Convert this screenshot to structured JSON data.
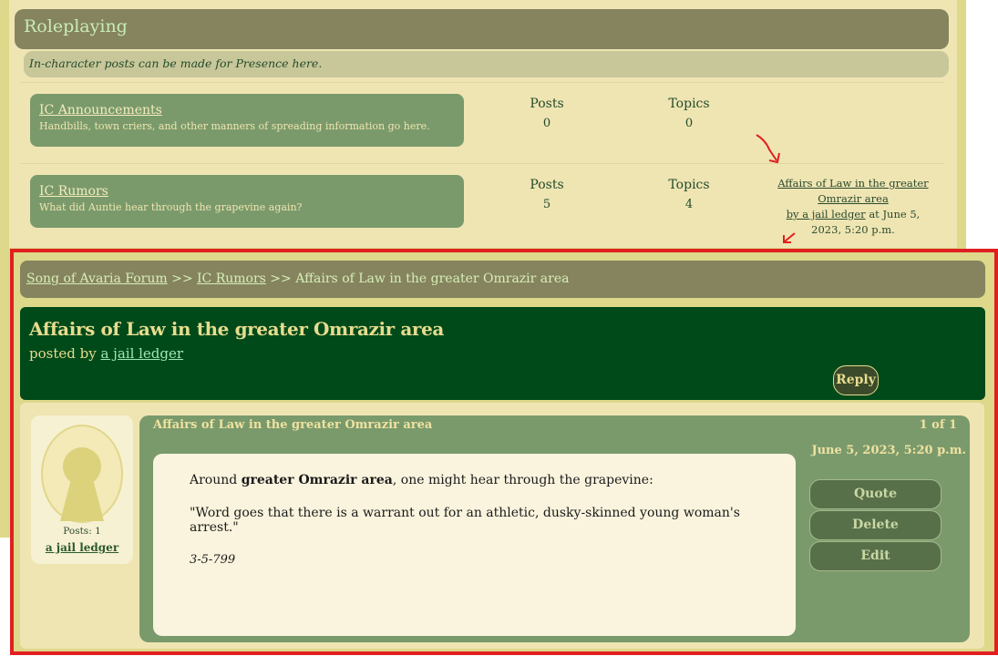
{
  "section": {
    "title": "Roleplaying",
    "description": "In-character posts can be made for Presence here."
  },
  "forums": [
    {
      "title": "IC Announcements",
      "description": "Handbills, town criers, and other manners of spreading information go here.",
      "posts_label": "Posts",
      "posts": "0",
      "topics_label": "Topics",
      "topics": "0"
    },
    {
      "title": "IC Rumors",
      "description": "What did Auntie hear through the grapevine again?",
      "posts_label": "Posts",
      "posts": "5",
      "topics_label": "Topics",
      "topics": "4",
      "last_post": {
        "title": "Affairs of Law in the greater Omrazir area",
        "by": "by a jail ledger",
        "date": "at June 5, 2023, 5:20 p.m."
      }
    }
  ],
  "breadcrumb": {
    "root": "Song of Avaria Forum",
    "sep1": " >> ",
    "forum": "IC Rumors",
    "sep2": " >> ",
    "topic": "Affairs of Law in the greater Omrazir area"
  },
  "topic": {
    "title": "Affairs of Law in the greater Omrazir area",
    "posted_by_label": "posted by",
    "author": "a jail ledger",
    "reply_label": "Reply"
  },
  "post": {
    "title": "Affairs of Law in the greater Omrazir area",
    "page": "1 of 1",
    "date": "June 5, 2023, 5:20 p.m.",
    "body_pre": "Around ",
    "body_bold": "greater Omrazir area",
    "body_post": ", one might hear through the grapevine:",
    "quote": "\"Word goes that there is a warrant out for an athletic, dusky-skinned young woman's arrest.\"",
    "signature": "3-5-799",
    "author_posts": "Posts: 1",
    "author": "a jail ledger",
    "actions": [
      "Quote",
      "Delete",
      "Edit"
    ]
  },
  "colors": {
    "page_bg": "#ddd88a",
    "header_olive": "#85845f",
    "topic_green": "#004a1a",
    "panel_green": "#7a9a6c",
    "highlight_red": "#e02020"
  }
}
